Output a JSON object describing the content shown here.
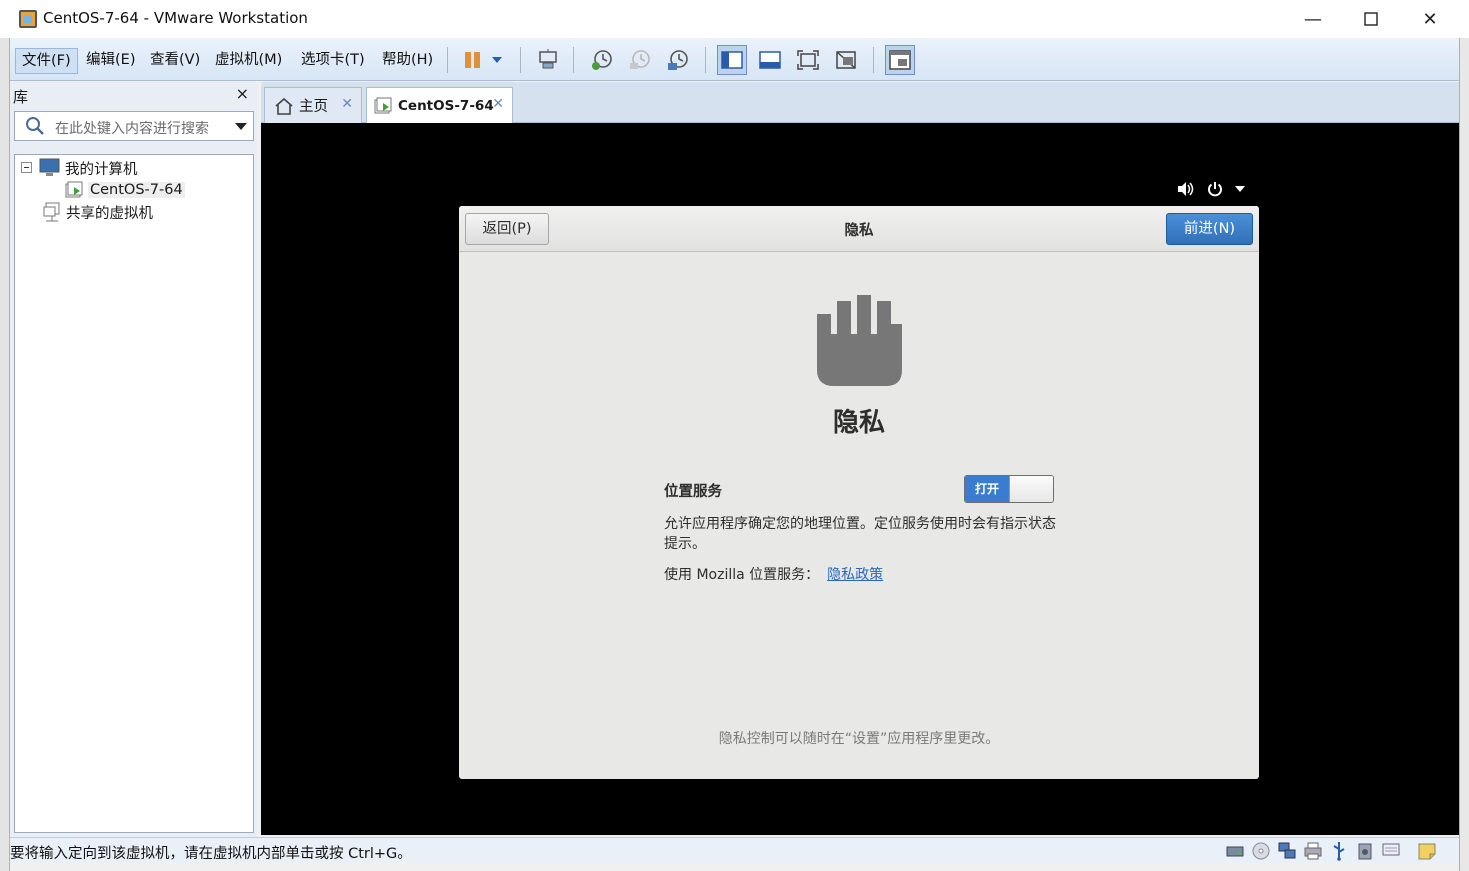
{
  "window": {
    "title": "CentOS-7-64 - VMware Workstation",
    "minimize_glyph": "—",
    "maximize_glyph": "☐",
    "close_glyph": "✕"
  },
  "menubar": {
    "items": [
      "文件(F)",
      "编辑(E)",
      "查看(V)",
      "虚拟机(M)",
      "选项卡(T)",
      "帮助(H)"
    ],
    "toolbar_icons": [
      "pause-icon",
      "dropdown-arrow-icon",
      "send-ctrl-alt-del-icon",
      "snapshot-take-icon",
      "snapshot-revert-icon",
      "snapshot-manager-icon",
      "library-view-icon",
      "thumbnail-bar-icon",
      "fullscreen-icon",
      "unity-icon",
      "console-view-icon"
    ]
  },
  "library": {
    "title": "库",
    "close_glyph": "×",
    "search_placeholder": "在此处键入内容进行搜索",
    "tree": {
      "my_computer": "我的计算机",
      "vm": "CentOS-7-64",
      "shared": "共享的虚拟机"
    }
  },
  "tabs": [
    {
      "label": "主页",
      "icon": "home-icon",
      "close": "✕"
    },
    {
      "label": "CentOS-7-64",
      "icon": "vm-icon",
      "close": "✕"
    }
  ],
  "guest": {
    "back_button": "返回(P)",
    "header_title": "隐私",
    "next_button": "前进(N)",
    "page_title": "隐私",
    "location_label": "位置服务",
    "switch_on_label": "打开",
    "location_enabled": true,
    "description": "允许应用程序确定您的地理位置。定位服务使用时会有指示状态提示。",
    "mozilla_text": "使用  Mozilla 位置服务：",
    "policy_link": "隐私政策",
    "footer_note": "隐私控制可以随时在“设置”应用程序里更改。"
  },
  "statusbar": {
    "message": "要将输入定向到该虚拟机，请在虚拟机内部单击或按 Ctrl+G。",
    "icons": [
      "hard-disk-icon",
      "cd-dvd-icon",
      "network-adapter-icon",
      "printer-icon",
      "usb-icon",
      "sound-card-icon",
      "display-icon",
      "notes-icon"
    ]
  },
  "colors": {
    "next_button": "#3a7dd0",
    "switch_on": "#3a7dd0",
    "link": "#2a6ab8",
    "menubar": "#dde9f7"
  }
}
